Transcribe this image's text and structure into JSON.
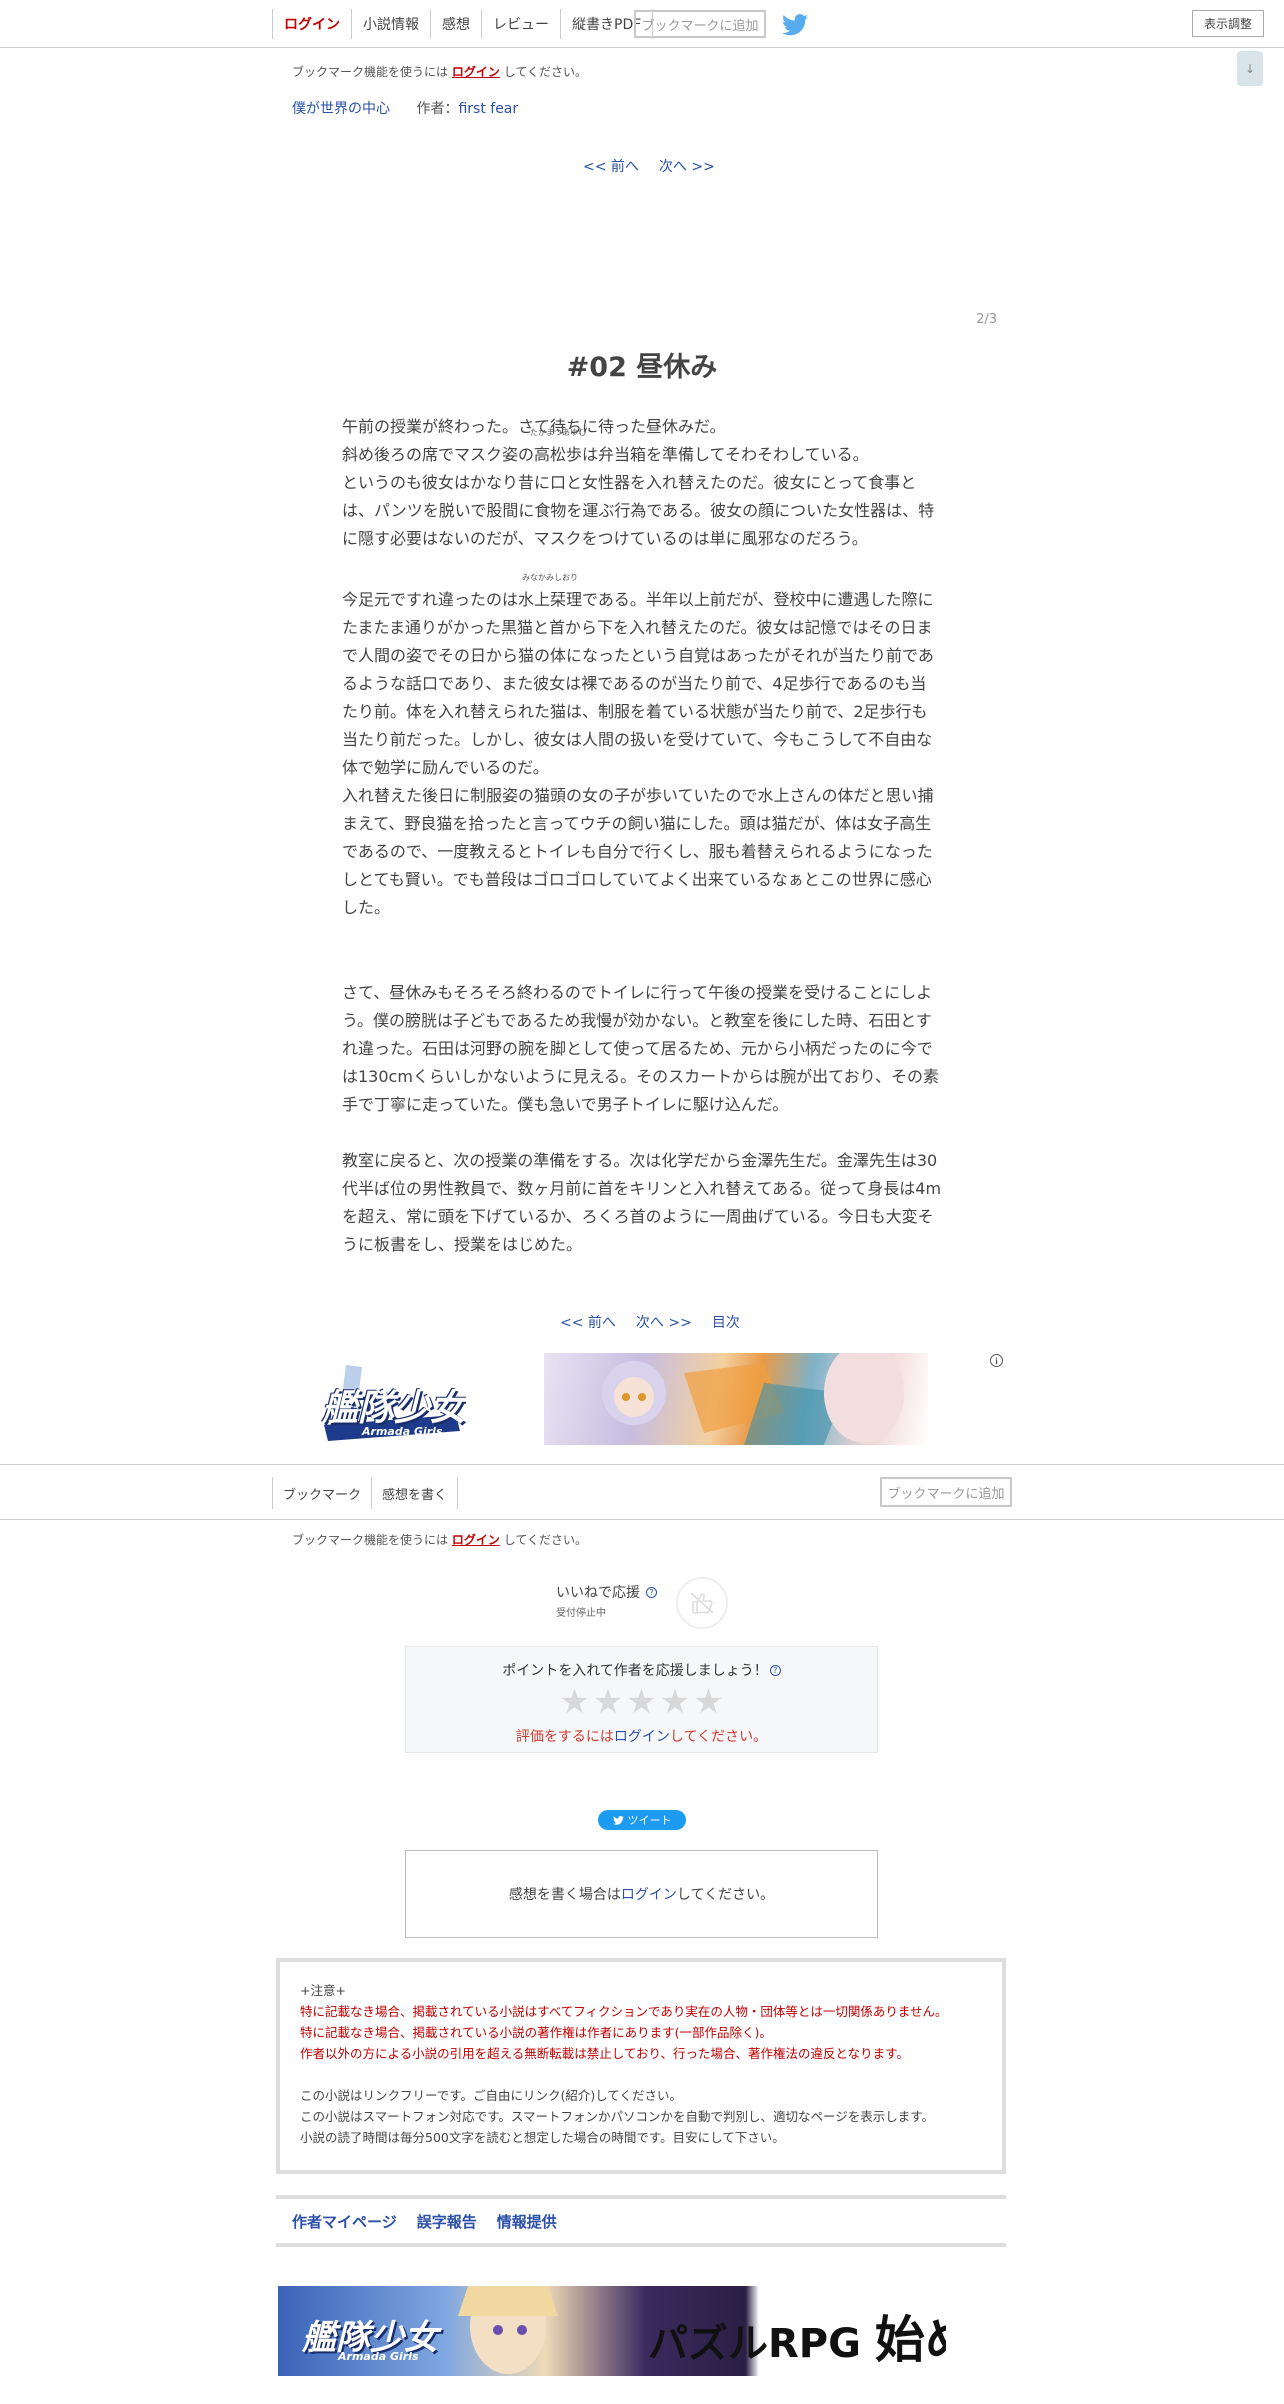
{
  "topnav": {
    "tabs": [
      "ログイン",
      "小説情報",
      "感想",
      "レビュー",
      "縦書きPDF"
    ],
    "bookmark_button": "ブックマークに追加",
    "display_settings": "表示調整",
    "scroll_label": "↓"
  },
  "bookmark_note": {
    "prefix": "ブックマーク機能を使うには",
    "link": "ログイン",
    "suffix": "してください。"
  },
  "series": {
    "title": "僕が世界の中心",
    "author_label": "作者：",
    "author": "first fear"
  },
  "pager_top": {
    "prev": "<< 前へ",
    "next": "次へ >>"
  },
  "page_count": "2/3",
  "chapter_title": "#02 昼休み",
  "body": {
    "p1_line1": "午前の授業が終わった。さて待ちに待った昼休みだ。",
    "p1_line2_pre": "斜め後ろの席でマスク姿の",
    "p1_ruby_base": "高松歩",
    "p1_ruby_text": "たかまつあゆむ",
    "p1_line2_post": "は弁当箱を準備してそわそわしている。",
    "p1_rest": "というのも彼女はかなり昔に口と女性器を入れ替えたのだ。彼女にとって食事とは、パンツを脱いで股間に食物を運ぶ行為である。彼女の顔についた女性器は、特に隠す必要はないのだが、マスクをつけているのは単に風邪なのだろう。",
    "p2_pre": "今足元ですれ違ったのは",
    "p2_ruby_base": "水上栞理",
    "p2_ruby_text": "みなかみしおり",
    "p2_post": "である。半年以上前だが、登校中に遭遇した際にたまたま通りがかった黒猫と首から下を入れ替えたのだ。彼女は記憶ではその日まで人間の姿でその日から猫の体になったという自覚はあったがそれが当たり前であるような話口であり、また彼女は裸であるのが当たり前で、4足歩行であるのも当たり前。体を入れ替えられた猫は、制服を着ている状態が当たり前で、2足歩行も当たり前だった。しかし、彼女は人間の扱いを受けていて、今もこうして不自由な体で勉学に励んでいるのだ。",
    "p3": "入れ替えた後日に制服姿の猫頭の女の子が歩いていたので水上さんの体だと思い捕まえて、野良猫を拾ったと言ってウチの飼い猫にした。頭は猫だが、体は女子高生であるので、一度教えるとトイレも自分で行くし、服も着替えられるようになったしとても賢い。でも普段はゴロゴロしていてよく出来ているなぁとこの世界に感心した。",
    "p4": "さて、昼休みもそろそろ終わるのでトイレに行って午後の授業を受けることにしよう。僕の膀胱は子どもであるため我慢が効かない。と教室を後にした時、石田とすれ違った。石田は河野の腕を脚として使って居るため、元から小柄だったのに今では130cmくらいしかないように見える。そのスカートからは腕が出ており、その素手で丁寧に走っていた。僕も急いで男子トイレに駆け込んだ。",
    "p5": "教室に戻ると、次の授業の準備をする。次は化学だから金澤先生だ。金澤先生は30代半ば位の男性教員で、数ヶ月前に首をキリンと入れ替えてある。従って身長は4mを超え、常に頭を下げているか、ろくろ首のように一周曲げている。今日も大変そうに板書をし、授業をはじめた。"
  },
  "pager_bottom": {
    "prev": "<< 前へ",
    "next": "次へ >>",
    "toc": "目次"
  },
  "ad1": {
    "logo": "艦隊少女",
    "logo_sub": "Armada Girls",
    "info": "i"
  },
  "bottomnav": {
    "tabs": [
      "ブックマーク",
      "感想を書く"
    ],
    "bookmark_button": "ブックマークに追加"
  },
  "like": {
    "label": "いいねで応援",
    "help": "?",
    "sub": "受付停止中"
  },
  "points": {
    "title": "ポイントを入れて作者を応援しましょう！",
    "help": "?",
    "stars": [
      "★",
      "★",
      "★",
      "★",
      "★"
    ],
    "login_pre": "評価をするには",
    "login_link": "ログイン",
    "login_post": "してください。"
  },
  "tweet": {
    "label": "ツイート"
  },
  "comment": {
    "pre": "感想を書く場合は",
    "link": "ログイン",
    "post": "してください。"
  },
  "notice": {
    "heading": "+注意+",
    "red_lines": [
      "特に記載なき場合、掲載されている小説はすべてフィクションであり実在の人物・団体等とは一切関係ありません。",
      "特に記載なき場合、掲載されている小説の著作権は作者にあります(一部作品除く)。",
      "作者以外の方による小説の引用を超える無断転載は禁止しており、行った場合、著作権法の違反となります。"
    ],
    "lines": [
      "この小説はリンクフリーです。ご自由にリンク(紹介)してください。",
      "この小説はスマートフォン対応です。スマートフォンかパソコンかを自動で判別し、適切なページを表示します。",
      "小説の読了時間は毎分500文字を読むと想定した場合の時間です。目安にして下さい。"
    ]
  },
  "footer_links": [
    "作者マイページ",
    "誤字報告",
    "情報提供"
  ],
  "ad2": {
    "logo": "艦隊少女",
    "logo_sub": "Armada Girls",
    "tagline_a": "パズルRPG",
    "tagline_b": "始める?"
  },
  "colors": {
    "accent_red": "#c20000",
    "link_blue": "#2b50a8",
    "twitter_blue": "#1d9bf0"
  }
}
